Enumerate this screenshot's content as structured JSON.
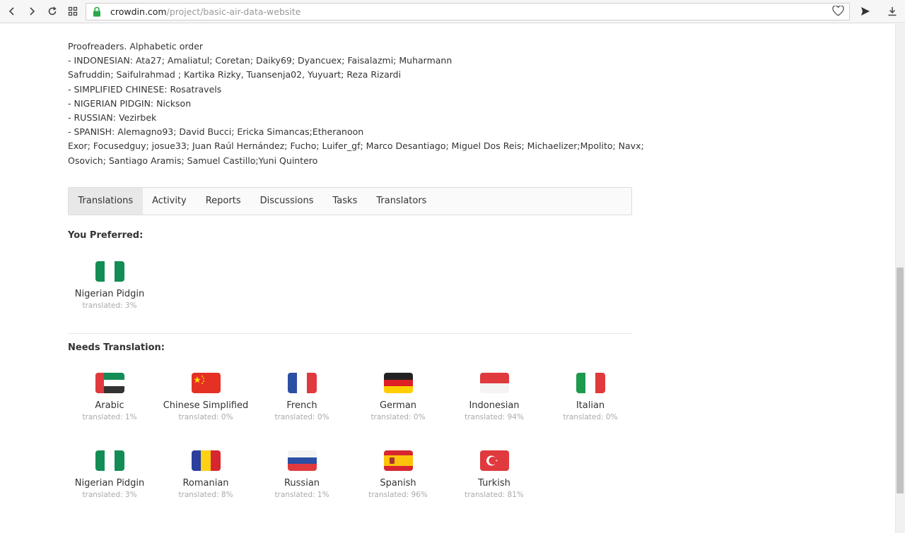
{
  "browser": {
    "url_host": "crowdin.com",
    "url_path": "/project/basic-air-data-website"
  },
  "proofreaders": {
    "lines": [
      "Proofreaders. Alphabetic order",
      "- INDONESIAN: Ata27; Amaliatul; Coretan; Daiky69; Dyancuex; Faisalazmi; Muharmann",
      "Safruddin; Saifulrahmad ; Kartika Rizky, Tuansenja02, Yuyuart; Reza Rizardi",
      "- SIMPLIFIED CHINESE: Rosatravels",
      "- NIGERIAN PIDGIN: Nickson",
      "- RUSSIAN: Vezirbek",
      "- SPANISH: Alemagno93; David Bucci; Ericka Simancas;Etheranoon",
      "Exor; Focusedguy; josue33; Juan Raúl Hernández; Fucho; Luifer_gf; Marco Desantiago; Miguel Dos Reis; Michaelizer;Mpolito; Navx;",
      "Osovich; Santiago Aramis; Samuel Castillo;Yuni Quintero"
    ]
  },
  "tabs": [
    "Translations",
    "Activity",
    "Reports",
    "Discussions",
    "Tasks",
    "Translators"
  ],
  "preferred": {
    "title": "You Preferred:",
    "items": [
      {
        "name": "Nigerian Pidgin",
        "pct": "translated: 3%",
        "flag": "ng"
      }
    ]
  },
  "needs": {
    "title": "Needs Translation:",
    "items": [
      {
        "name": "Arabic",
        "pct": "translated: 1%",
        "flag": "ae"
      },
      {
        "name": "Chinese Simplified",
        "pct": "translated: 0%",
        "flag": "cn"
      },
      {
        "name": "French",
        "pct": "translated: 0%",
        "flag": "fr"
      },
      {
        "name": "German",
        "pct": "translated: 0%",
        "flag": "de"
      },
      {
        "name": "Indonesian",
        "pct": "translated: 94%",
        "flag": "id"
      },
      {
        "name": "Italian",
        "pct": "translated: 0%",
        "flag": "it"
      },
      {
        "name": "Nigerian Pidgin",
        "pct": "translated: 3%",
        "flag": "ng"
      },
      {
        "name": "Romanian",
        "pct": "translated: 8%",
        "flag": "ro"
      },
      {
        "name": "Russian",
        "pct": "translated: 1%",
        "flag": "ru"
      },
      {
        "name": "Spanish",
        "pct": "translated: 96%",
        "flag": "es"
      },
      {
        "name": "Turkish",
        "pct": "translated: 81%",
        "flag": "tr"
      }
    ]
  },
  "colors": {
    "flag_green": "#138d55",
    "flag_red": "#e03a3e",
    "flag_blue": "#2b4fa3"
  }
}
